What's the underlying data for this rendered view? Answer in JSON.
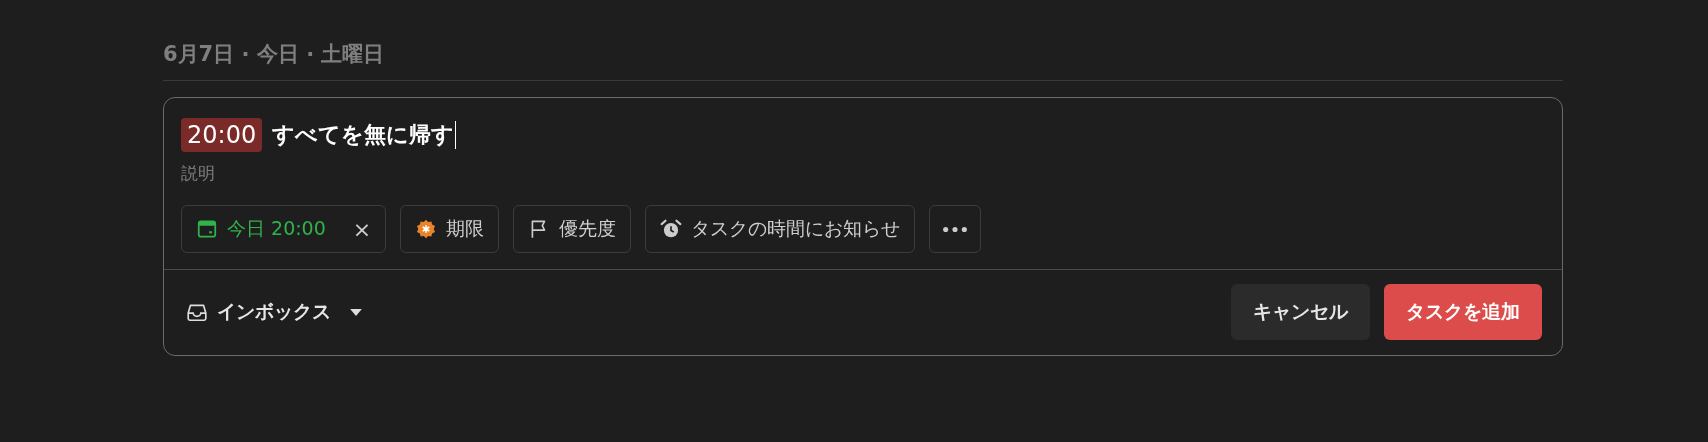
{
  "section_heading": "6月7日 · 今日 · 土曜日",
  "task_editor": {
    "time_tag": "20:00",
    "title": "すべてを無に帰す",
    "description": {
      "placeholder": "説明"
    },
    "chips": [
      {
        "kind": "date",
        "label": "今日 20:00",
        "clear": "×"
      },
      {
        "kind": "deadline",
        "label": "期限"
      },
      {
        "kind": "priority",
        "label": "優先度"
      },
      {
        "kind": "reminder",
        "label": "タスクの時間にお知らせ"
      },
      {
        "kind": "more"
      }
    ],
    "project": "インボックス",
    "buttons": [
      {
        "kind": "cancel",
        "label": "キャンセル"
      },
      {
        "kind": "submit",
        "label": "タスクを追加"
      }
    ]
  }
}
